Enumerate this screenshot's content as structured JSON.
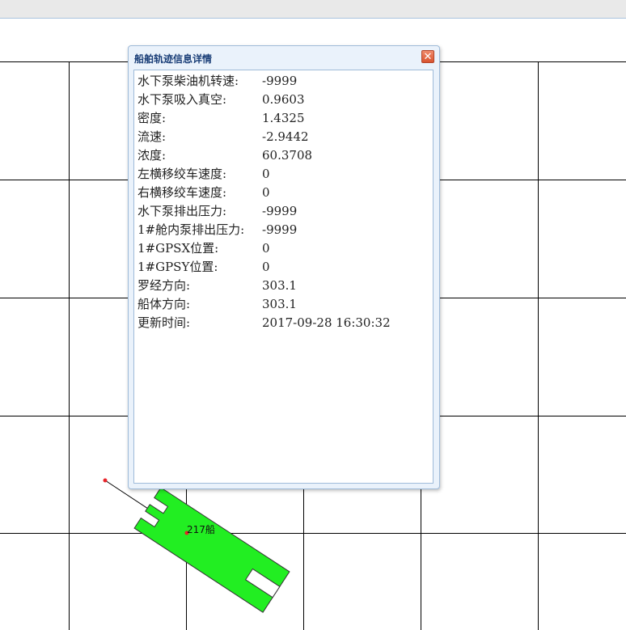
{
  "popup": {
    "title": "船舶轨迹信息详情",
    "close_symbol": "✕",
    "rows": [
      {
        "label": "水下泵柴油机转速:",
        "value": "-9999"
      },
      {
        "label": "水下泵吸入真空:",
        "value": "0.9603"
      },
      {
        "label": "密度:",
        "value": "1.4325"
      },
      {
        "label": "流速:",
        "value": "-2.9442"
      },
      {
        "label": "浓度:",
        "value": "60.3708"
      },
      {
        "label": "左横移绞车速度:",
        "value": "0"
      },
      {
        "label": "右横移绞车速度:",
        "value": "0"
      },
      {
        "label": "水下泵排出压力:",
        "value": "-9999"
      },
      {
        "label": "1#舱内泵排出压力:",
        "value": "-9999"
      },
      {
        "label": "1#GPSX位置:",
        "value": "0"
      },
      {
        "label": "1#GPSY位置:",
        "value": "0"
      },
      {
        "label": "罗经方向:",
        "value": "303.1"
      },
      {
        "label": "船体方向:",
        "value": "303.1"
      },
      {
        "label": "更新时间:",
        "value": "2017-09-28 16:30:32"
      }
    ]
  },
  "ship": {
    "label": "217船",
    "color": "#22ee22",
    "heading_deg": 303.1
  },
  "colors": {
    "annotation": "#e8242a",
    "grid": "#000000",
    "title_text": "#1b3f78"
  },
  "icons": {
    "close": "close-icon"
  }
}
